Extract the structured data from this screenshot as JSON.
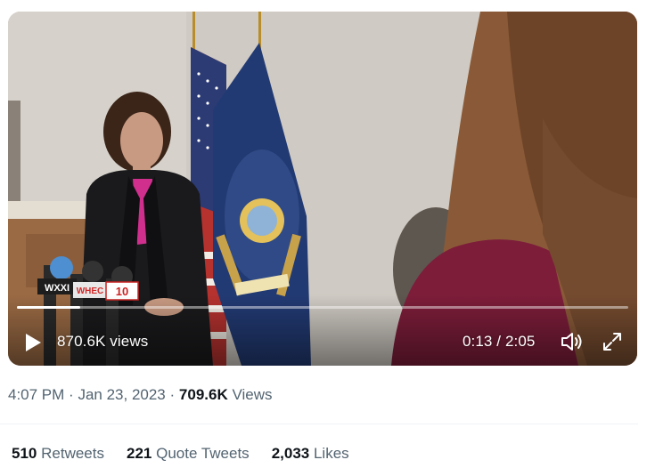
{
  "video": {
    "overlay_views": "870.6K views",
    "time_display": "0:13 / 2:05",
    "progress": 0.104,
    "mic_labels": [
      "WXXI",
      "WHEC",
      "10"
    ],
    "icons": {
      "play": "play-icon",
      "volume": "volume-icon",
      "fullscreen": "fullscreen-icon"
    }
  },
  "tweet_meta": {
    "time": "4:07 PM",
    "sep1": "·",
    "date": "Jan 23, 2023",
    "sep2": "·",
    "views_count": "709.6K",
    "views_label": "Views"
  },
  "stats": [
    {
      "count": "510",
      "label": "Retweets"
    },
    {
      "count": "221",
      "label": "Quote Tweets"
    },
    {
      "count": "2,033",
      "label": "Likes"
    }
  ],
  "colors": {
    "muted_text": "#536471",
    "primary_text": "#0f1419",
    "divider": "#eff3f4"
  }
}
